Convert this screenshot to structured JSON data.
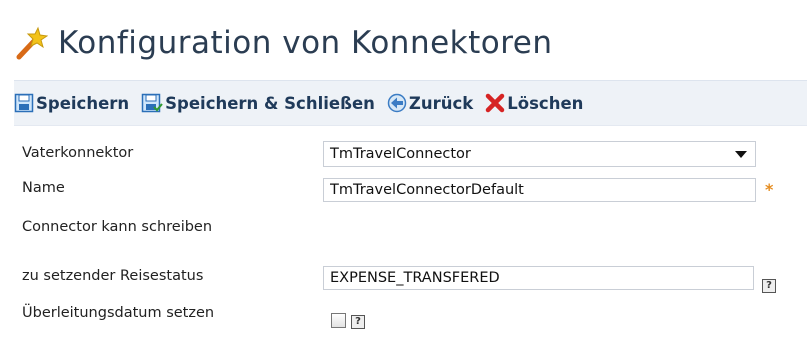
{
  "page": {
    "title": "Konfiguration von Konnektoren"
  },
  "toolbar": {
    "save": "Speichern",
    "save_close": "Speichern & Schließen",
    "back": "Zurück",
    "delete": "Löschen"
  },
  "form": {
    "parent_connector": {
      "label": "Vaterkonnektor",
      "value": "TmTravelConnector"
    },
    "name": {
      "label": "Name",
      "value": "TmTravelConnectorDefault",
      "required_marker": "*"
    },
    "can_write": {
      "label": "Connector kann schreiben"
    },
    "travel_status": {
      "label": "zu setzender Reisestatus",
      "value": "EXPENSE_TRANSFERED"
    },
    "transfer_date": {
      "label": "Überleitungsdatum setzen",
      "checked": false
    }
  },
  "help_marker": "?",
  "colors": {
    "title": "#2b3d52",
    "toolbar_bg": "#eef2f7",
    "required": "#e58c1f"
  }
}
